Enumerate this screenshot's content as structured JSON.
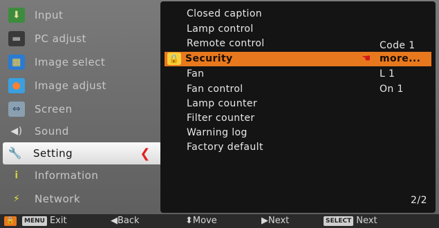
{
  "menu": {
    "items": [
      {
        "label": "Input",
        "icon": "input-icon",
        "color": "#3d8c3d"
      },
      {
        "label": "PC adjust",
        "icon": "monitor-icon",
        "color": "#444444"
      },
      {
        "label": "Image select",
        "icon": "image-select-icon",
        "color": "#2a7bd1"
      },
      {
        "label": "Image adjust",
        "icon": "image-adjust-icon",
        "color": "#3aa0e0"
      },
      {
        "label": "Screen",
        "icon": "screen-icon",
        "color": "#8aa0b0"
      },
      {
        "label": "Sound",
        "icon": "speaker-icon",
        "color": "#8a8a8a"
      },
      {
        "label": "Setting",
        "icon": "tools-icon",
        "color": "#d04040"
      },
      {
        "label": "Information",
        "icon": "info-icon",
        "color": "#6aa030"
      },
      {
        "label": "Network",
        "icon": "network-icon",
        "color": "#d0d040"
      }
    ],
    "active_index": 6
  },
  "panel": {
    "rows": [
      {
        "label": "Closed caption",
        "value": ""
      },
      {
        "label": "Lamp control",
        "value": ""
      },
      {
        "label": "Remote control",
        "value": "Code 1"
      },
      {
        "label": "Security",
        "value": "more..."
      },
      {
        "label": "Fan",
        "value": "L 1"
      },
      {
        "label": "Fan control",
        "value": "On 1"
      },
      {
        "label": "Lamp counter",
        "value": ""
      },
      {
        "label": "Filter counter",
        "value": ""
      },
      {
        "label": "Warning log",
        "value": ""
      },
      {
        "label": "Factory default",
        "value": ""
      }
    ],
    "highlight_index": 3,
    "page": "2/2"
  },
  "bottom": {
    "exit_key": "MENU",
    "exit_label": "Exit",
    "back_label": "◀Back",
    "move_label": "⬍Move",
    "next_label": "▶Next",
    "select_key": "SELECT",
    "select_label": "Next"
  },
  "colors": {
    "highlight": "#e8781e",
    "panel_bg": "#141414",
    "active_item_bg": "#f0f0f0",
    "pointer": "#e02020"
  }
}
